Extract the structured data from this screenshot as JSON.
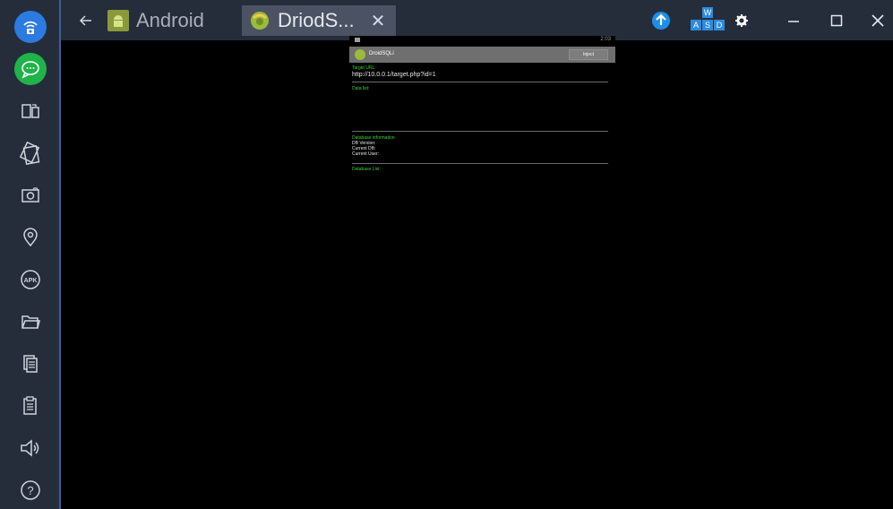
{
  "topbar": {
    "tabs": [
      {
        "label": "Android"
      },
      {
        "label": "DriodS..."
      }
    ],
    "keymap": {
      "top": "W",
      "bottom": [
        "A",
        "S",
        "D"
      ]
    }
  },
  "app": {
    "status_time": "2:03",
    "title": "DroidSQLi",
    "inject_label": "Inject",
    "target_url_label": "Target URL:",
    "target_url_value": "http://10.0.0.1/target.php?id=1",
    "data_list_label": "Data list:",
    "db_info_label": "Database information:",
    "db_version_label": "DB Version:",
    "current_db_label": "Current DB:",
    "current_user_label": "Current User:",
    "db_list_label": "Database List:"
  },
  "colors": {
    "sidebar_bg": "#252d3b",
    "accent_green": "#35d035",
    "accent_blue": "#1e8fe6"
  },
  "icons": {
    "sidebar": [
      "camera-icon",
      "chat-icon",
      "multi-window-icon",
      "rotate-icon",
      "screenshot-icon",
      "location-icon",
      "apk-icon",
      "folder-icon",
      "copy-icon",
      "paste-icon",
      "volume-icon",
      "help-icon"
    ]
  }
}
